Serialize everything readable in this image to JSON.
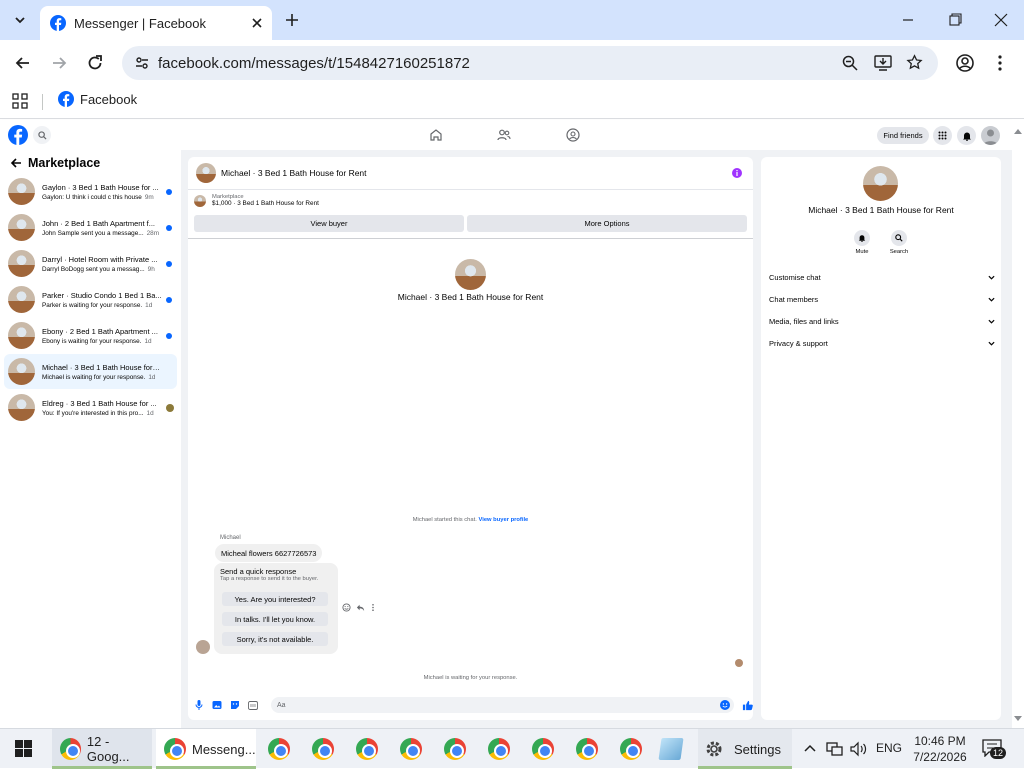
{
  "browser": {
    "tab_title": "Messenger | Facebook",
    "url": "facebook.com/messages/t/1548427160251872",
    "bookmark_label": "Facebook"
  },
  "fb_header": {
    "find_friends": "Find friends"
  },
  "sidebar": {
    "title": "Marketplace",
    "conversations": [
      {
        "title": "Gaylon · 3 Bed 1 Bath House for ...",
        "preview": "Gaylon: U think i could c this house",
        "time": "9m",
        "unread": true
      },
      {
        "title": "John · 2 Bed 1 Bath Apartment f...",
        "preview": "John Sample sent you a message...",
        "time": "28m",
        "unread": true
      },
      {
        "title": "Darryl · Hotel Room with Private ...",
        "preview": "Darryl BoDogg sent you a messag...",
        "time": "9h",
        "unread": true
      },
      {
        "title": "Parker · Studio Condo 1 Bed 1 Ba...",
        "preview": "Parker is waiting for your response.",
        "time": "1d",
        "unread": true
      },
      {
        "title": "Ebony · 2 Bed 1 Bath Apartment ...",
        "preview": "Ebony is waiting for your response.",
        "time": "1d",
        "unread": true
      },
      {
        "title": "Michael · 3 Bed 1 Bath House for R...",
        "preview": "Michael is waiting for your response.",
        "time": "1d",
        "unread": false
      },
      {
        "title": "Eldreg · 3 Bed 1 Bath House for ...",
        "preview": "You: If you're interested in this pro...",
        "time": "1d",
        "unread": false
      }
    ]
  },
  "chat": {
    "header_title": "Michael · 3 Bed 1 Bath House for Rent",
    "listing_label": "Marketplace",
    "listing_price": "$1,000 · 3 Bed 1 Bath House for Rent",
    "view_buyer": "View buyer",
    "more_options": "More Options",
    "intro_title": "Michael · 3 Bed 1 Bath House for Rent",
    "started_text": "Michael started this chat.",
    "view_buyer_profile": "View buyer profile",
    "sender_name": "Michael",
    "message": "Micheal flowers 6627726573",
    "quick_title": "Send a quick response",
    "quick_sub": "Tap a response to send it to the buyer.",
    "quick_options": [
      "Yes. Are you interested?",
      "In talks. I'll let you know.",
      "Sorry, it's not available."
    ],
    "waiting_text": "Michael is waiting for your response.",
    "input_placeholder": "Aa"
  },
  "details": {
    "title": "Michael · 3 Bed 1 Bath House for Rent",
    "mute": "Mute",
    "search": "Search",
    "sections": [
      "Customise chat",
      "Chat members",
      "Media, files and links",
      "Privacy & support"
    ]
  },
  "taskbar": {
    "chrome1_label": "12 - Goog...",
    "chrome2_label": "Messeng...",
    "settings_label": "Settings",
    "lang": "ENG",
    "time": "10:46 PM",
    "date": "7/22/2026",
    "notif_count": "12"
  },
  "colors": {
    "accent": "#0866ff",
    "tab_strip": "#d3e3fd",
    "purple_info": "#a033ff"
  }
}
